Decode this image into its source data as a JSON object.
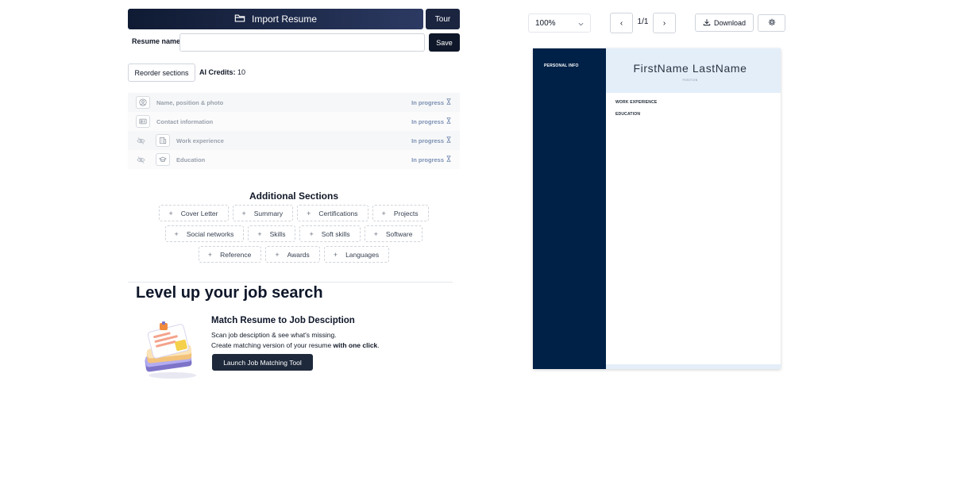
{
  "editor": {
    "import_label": "Import Resume",
    "tour_label": "Tour",
    "resume_name_label": "Resume name",
    "resume_name_value": "",
    "resume_name_placeholder": "",
    "save_label": "Save",
    "reorder_label": "Reorder sections",
    "credits_label": "AI Credits:",
    "credits_value": "10"
  },
  "sections": [
    {
      "label": "Name, position & photo",
      "status": "In progress",
      "icon": "user-circle-icon",
      "hideable": false
    },
    {
      "label": "Contact information",
      "status": "In progress",
      "icon": "id-card-icon",
      "hideable": false
    },
    {
      "label": "Work experience",
      "status": "In progress",
      "icon": "building-icon",
      "hideable": true
    },
    {
      "label": "Education",
      "status": "In progress",
      "icon": "graduation-cap-icon",
      "hideable": true
    }
  ],
  "additional": {
    "title": "Additional Sections",
    "rows": [
      [
        "Cover Letter",
        "Summary",
        "Certifications",
        "Projects"
      ],
      [
        "Social networks",
        "Skills",
        "Soft skills",
        "Software"
      ],
      [
        "Reference",
        "Awards",
        "Languages"
      ]
    ]
  },
  "promo": {
    "heading": "Level up your job search",
    "match_title": "Match Resume to Job Desciption",
    "line1": "Scan job desciption & see what's missing.",
    "line2_prefix": "Create matching version of your resume ",
    "line2_bold": "with one click",
    "line2_suffix": ".",
    "launch_label": "Launch Job Matching Tool"
  },
  "preview": {
    "zoom": "100%",
    "prev_label": "‹",
    "next_label": "›",
    "page_indicator": "1/1",
    "download_label": "Download",
    "resume": {
      "sidebar_heading": "PERSONAL INFO",
      "name": "FirstName LastName",
      "position": "POSITION",
      "work_heading": "WORK EXPERIENCE",
      "education_heading": "EDUCATION"
    }
  },
  "colors": {
    "sidebar_navy": "#002147",
    "header_tint": "#e3eef9",
    "status_text": "#7b90b3",
    "primary_button": "#0f172a"
  }
}
